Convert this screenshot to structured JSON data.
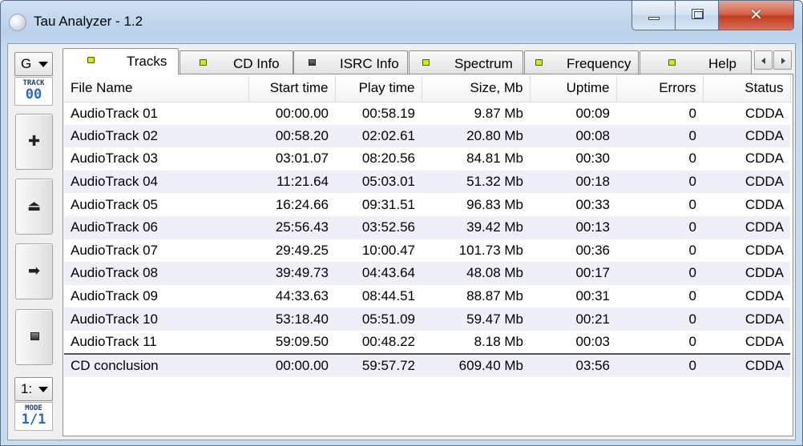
{
  "window": {
    "title": "Tau Analyzer - 1.2",
    "close_glyph": "✕"
  },
  "toolbar": {
    "drive_combo": "G",
    "track_label": "TRACK",
    "track_value": "00",
    "add_glyph": "✚",
    "eject_glyph": "⏏",
    "next_glyph": "➡",
    "speed_combo": "1:",
    "mode_label": "MODE",
    "mode_value": "1/1"
  },
  "tabs": [
    {
      "label": "Tracks",
      "led": "green",
      "active": true
    },
    {
      "label": "CD Info",
      "led": "green",
      "active": false
    },
    {
      "label": "ISRC Info",
      "led": "dark",
      "active": false
    },
    {
      "label": "Spectrum",
      "led": "green",
      "active": false
    },
    {
      "label": "Frequency",
      "led": "green",
      "active": false
    },
    {
      "label": "Help",
      "led": "green",
      "active": false
    }
  ],
  "table": {
    "columns": [
      "File Name",
      "Start time",
      "Play time",
      "Size, Mb",
      "Uptime",
      "Errors",
      "Status"
    ],
    "rows": [
      [
        "AudioTrack 01",
        "00:00.00",
        "00:58.19",
        "9.87 Mb",
        "00:09",
        "0",
        "CDDA"
      ],
      [
        "AudioTrack 02",
        "00:58.20",
        "02:02.61",
        "20.80 Mb",
        "00:08",
        "0",
        "CDDA"
      ],
      [
        "AudioTrack 03",
        "03:01.07",
        "08:20.56",
        "84.81 Mb",
        "00:30",
        "0",
        "CDDA"
      ],
      [
        "AudioTrack 04",
        "11:21.64",
        "05:03.01",
        "51.32 Mb",
        "00:18",
        "0",
        "CDDA"
      ],
      [
        "AudioTrack 05",
        "16:24.66",
        "09:31.51",
        "96.83 Mb",
        "00:33",
        "0",
        "CDDA"
      ],
      [
        "AudioTrack 06",
        "25:56.43",
        "03:52.56",
        "39.42 Mb",
        "00:13",
        "0",
        "CDDA"
      ],
      [
        "AudioTrack 07",
        "29:49.25",
        "10:00.47",
        "101.73 Mb",
        "00:36",
        "0",
        "CDDA"
      ],
      [
        "AudioTrack 08",
        "39:49.73",
        "04:43.64",
        "48.08 Mb",
        "00:17",
        "0",
        "CDDA"
      ],
      [
        "AudioTrack 09",
        "44:33.63",
        "08:44.51",
        "88.87 Mb",
        "00:31",
        "0",
        "CDDA"
      ],
      [
        "AudioTrack 10",
        "53:18.40",
        "05:51.09",
        "59.47 Mb",
        "00:21",
        "0",
        "CDDA"
      ],
      [
        "AudioTrack 11",
        "59:09.50",
        "00:48.22",
        "8.18 Mb",
        "00:03",
        "0",
        "CDDA"
      ]
    ],
    "summary": [
      "CD conclusion",
      "00:00.00",
      "59:57.72",
      "609.40 Mb",
      "03:56",
      "0",
      "CDDA"
    ]
  },
  "colors": {
    "led_green": "#c9f000",
    "lcd_text": "#2a66c8",
    "close_button": "#c23c1e",
    "alt_row": "#efeffa"
  }
}
